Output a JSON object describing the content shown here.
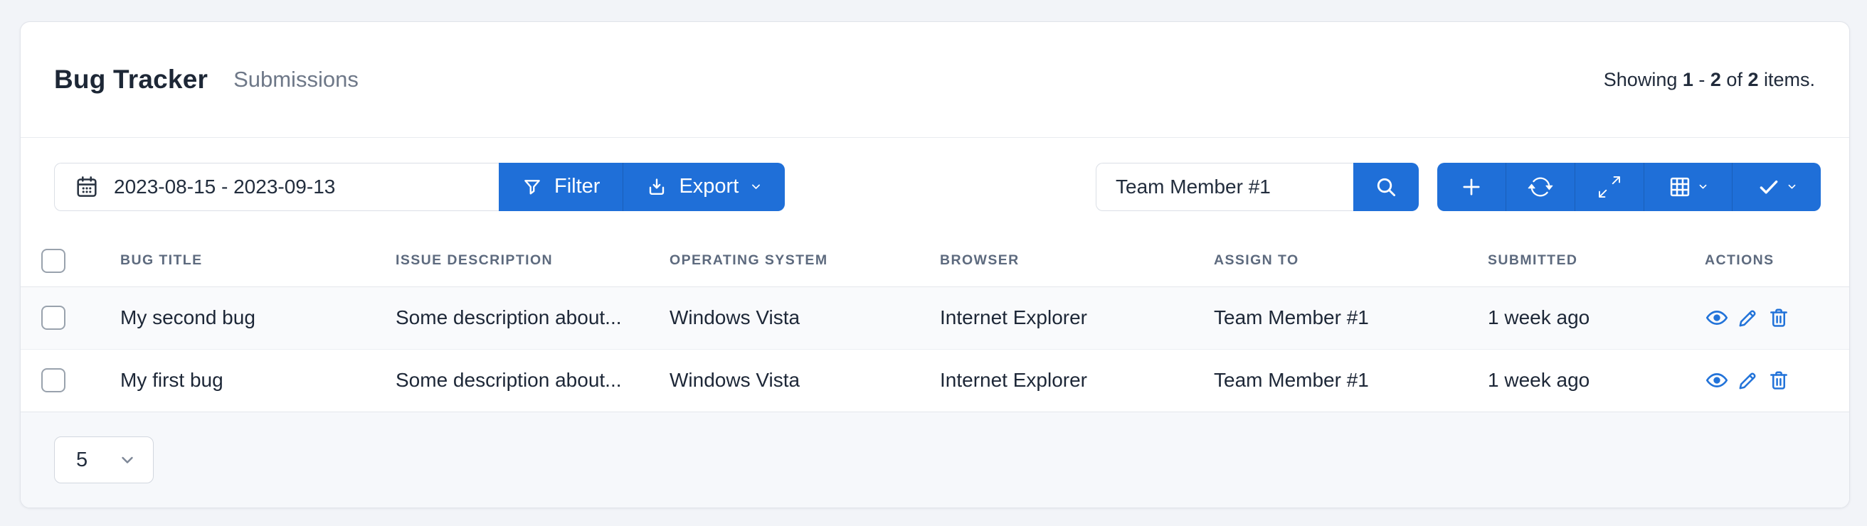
{
  "header": {
    "title": "Bug Tracker",
    "subtitle": "Submissions",
    "summary": {
      "showing": "Showing ",
      "range_start": "1",
      "separator": " - ",
      "range_end": "2",
      "of": " of ",
      "total": "2",
      "items": " items."
    }
  },
  "toolbar": {
    "date_range_value": "2023-08-15 - 2023-09-13",
    "filter_label": "Filter",
    "export_label": "Export",
    "search_value": "Team Member #1"
  },
  "icons": [
    "calendar-icon",
    "filter-funnel-icon",
    "export-download-icon",
    "chevron-down-icon",
    "search-icon",
    "plus-icon",
    "refresh-icon",
    "expand-icon",
    "grid-columns-icon",
    "check-icon",
    "view-eye-icon",
    "edit-pencil-icon",
    "delete-trash-icon"
  ],
  "colors": {
    "primary_blue": "#1f6fd8",
    "action_icon_blue": "#2273d9",
    "stripe_row": "#f9fafc",
    "footer_bg": "#f6f8fb"
  },
  "table": {
    "columns": [
      "BUG TITLE",
      "ISSUE DESCRIPTION",
      "OPERATING SYSTEM",
      "BROWSER",
      "ASSIGN TO",
      "SUBMITTED",
      "ACTIONS"
    ],
    "rows": [
      {
        "bug_title": "My second bug",
        "issue_description": "Some description about...",
        "operating_system": "Windows Vista",
        "browser": "Internet Explorer",
        "assign_to": "Team Member #1",
        "submitted": "1 week ago"
      },
      {
        "bug_title": "My first bug",
        "issue_description": "Some description about...",
        "operating_system": "Windows Vista",
        "browser": "Internet Explorer",
        "assign_to": "Team Member #1",
        "submitted": "1 week ago"
      }
    ]
  },
  "footer": {
    "page_size": "5"
  }
}
